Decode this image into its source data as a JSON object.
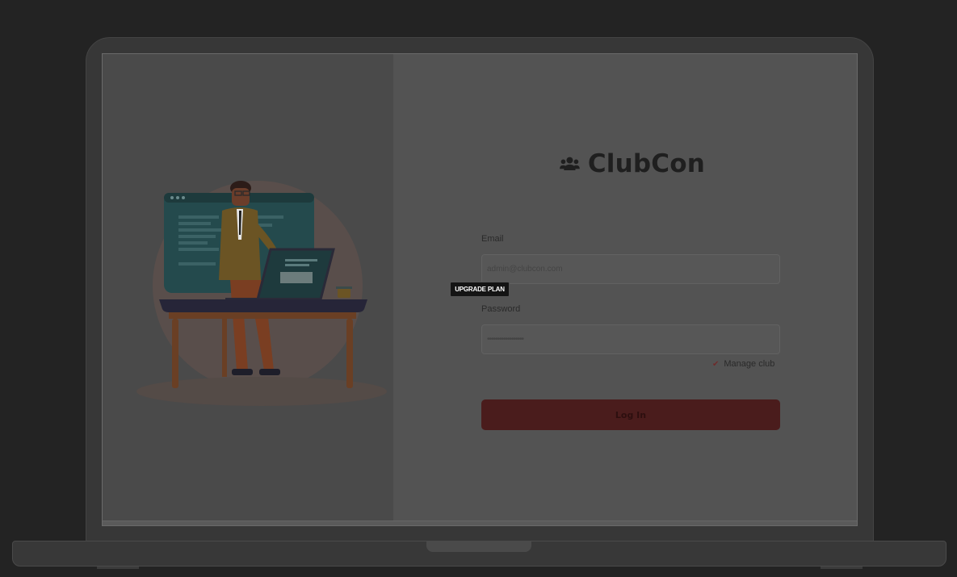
{
  "brand": {
    "name": "ClubCon",
    "icon": "users-icon"
  },
  "form": {
    "email_label": "Email",
    "email_placeholder": "admin@clubcon.com",
    "password_label": "Password",
    "password_value": "••••••••••••••••••",
    "manage_club_label": "Manage club",
    "manage_club_checked": true,
    "login_label": "Log In"
  },
  "badge": {
    "label": "UPGRADE PLAN"
  },
  "colors": {
    "accent": "#4a1c1c",
    "screen": "#535353",
    "left_panel": "#4a4a4a"
  }
}
